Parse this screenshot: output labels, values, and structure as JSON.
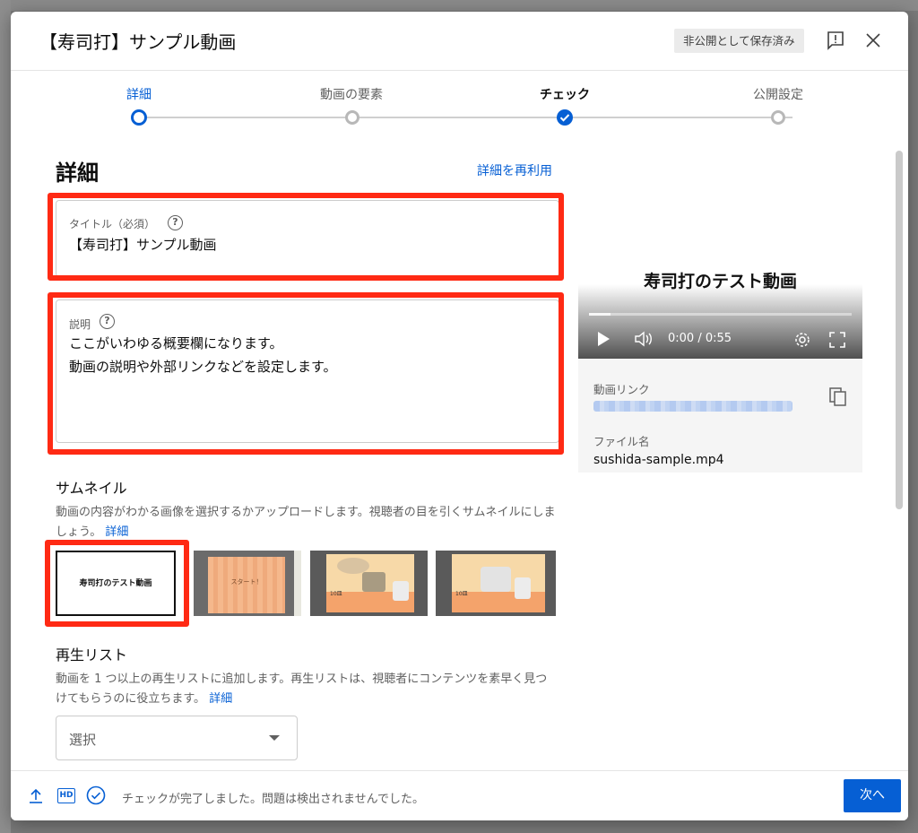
{
  "dialog": {
    "title": "【寿司打】サンプル動画",
    "saved_badge": "非公開として保存済み"
  },
  "stepper": {
    "steps": [
      {
        "label": "詳細",
        "state": "current"
      },
      {
        "label": "動画の要素",
        "state": "todo"
      },
      {
        "label": "チェック",
        "state": "done"
      },
      {
        "label": "公開設定",
        "state": "todo"
      }
    ]
  },
  "details": {
    "heading": "詳細",
    "reuse_link": "詳細を再利用",
    "title_field": {
      "label": "タイトル（必須）",
      "value": "【寿司打】サンプル動画"
    },
    "description_field": {
      "label": "説明",
      "lines": [
        "ここがいわゆる概要欄になります。",
        "動画の説明や外部リンクなどを設定します。"
      ]
    }
  },
  "thumbnail": {
    "heading": "サムネイル",
    "description": "動画の内容がわかる画像を選択するかアップロードします。視聴者の目を引くサムネイルにしましょう。",
    "link": "詳細",
    "selected_text": "寿司打のテスト動画",
    "option2_text": "スタート！",
    "badges": [
      "10皿",
      "10皿"
    ]
  },
  "playlist": {
    "heading": "再生リスト",
    "description": "動画を 1 つ以上の再生リストに追加します。再生リストは、視聴者にコンテンツを素早く見つけてもらうのに役立ちます。",
    "link": "詳細",
    "select_value": "選択"
  },
  "preview": {
    "video_title": "寿司打のテスト動画",
    "time": "0:00 / 0:55",
    "link_label": "動画リンク",
    "filename_label": "ファイル名",
    "filename": "sushida-sample.mp4"
  },
  "footer": {
    "hd_label": "HD",
    "status": "チェックが完了しました。問題は検出されませんでした。",
    "next_button": "次へ"
  },
  "colors": {
    "accent": "#065fd4",
    "highlight_frame": "#ff2a14"
  }
}
